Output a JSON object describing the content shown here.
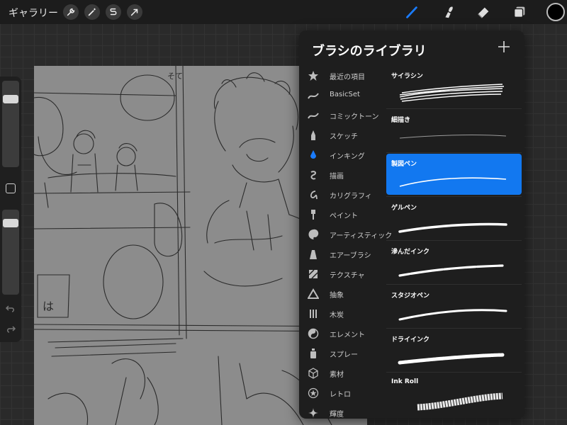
{
  "toolbar": {
    "gallery_label": "ギャラリー",
    "left_tools": [
      "wrench-icon",
      "magic-wand-icon",
      "selection-icon",
      "transform-arrow-icon"
    ],
    "right_tools": [
      "brush-icon",
      "smudge-icon",
      "eraser-icon",
      "layers-icon"
    ],
    "active_tool": "brush-icon",
    "active_tool_color": "#1a7cff",
    "current_color": "#000000"
  },
  "sidebar": {
    "brush_size_level": 0.18,
    "opacity_level": 0.12
  },
  "brush_library": {
    "title": "ブラシのライブラリ",
    "add_label": "+",
    "categories": [
      {
        "label": "最近の項目",
        "icon": "star-icon"
      },
      {
        "label": "BasicSet",
        "icon": "stroke-icon"
      },
      {
        "label": "コミックトーン",
        "icon": "stroke-icon"
      },
      {
        "label": "スケッチ",
        "icon": "pencil-icon"
      },
      {
        "label": "インキング",
        "icon": "ink-drop-icon"
      },
      {
        "label": "描画",
        "icon": "spiral-icon"
      },
      {
        "label": "カリグラフィ",
        "icon": "calligraphy-icon"
      },
      {
        "label": "ペイント",
        "icon": "paintbrush-icon"
      },
      {
        "label": "アーティスティック",
        "icon": "palette-icon"
      },
      {
        "label": "エアーブラシ",
        "icon": "airbrush-icon"
      },
      {
        "label": "テクスチャ",
        "icon": "texture-icon"
      },
      {
        "label": "抽象",
        "icon": "triangle-icon"
      },
      {
        "label": "木炭",
        "icon": "charcoal-icon"
      },
      {
        "label": "エレメント",
        "icon": "yin-yang-icon"
      },
      {
        "label": "スプレー",
        "icon": "spray-can-icon"
      },
      {
        "label": "素材",
        "icon": "cube-icon"
      },
      {
        "label": "レトロ",
        "icon": "retro-star-icon"
      },
      {
        "label": "輝度",
        "icon": "sparkle-icon"
      }
    ],
    "active_category": "インキング",
    "brushes": [
      {
        "name": "サイラシン"
      },
      {
        "name": "細描き"
      },
      {
        "name": "製図ペン"
      },
      {
        "name": "ゲルペン"
      },
      {
        "name": "滲んだインク"
      },
      {
        "name": "スタジオペン"
      },
      {
        "name": "ドライインク"
      },
      {
        "name": "Ink Roll"
      }
    ],
    "selected_brush": "製図ペン",
    "selected_color": "#1278f0"
  },
  "canvas": {
    "sketch_text_1": "は",
    "sketch_text_2": "そて"
  }
}
